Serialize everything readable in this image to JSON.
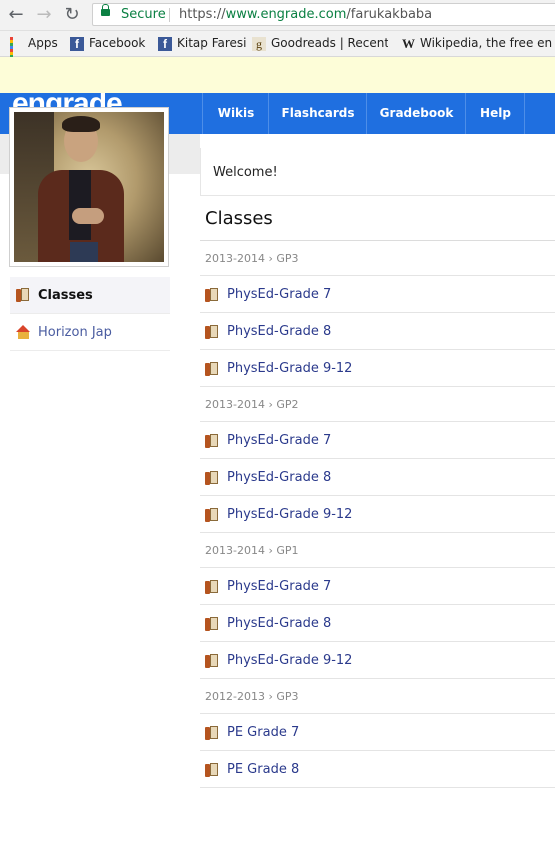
{
  "browser": {
    "secure_label": "Secure",
    "url_scheme": "https://",
    "url_host": "www.engrade.com",
    "url_path": "/farukakbaba",
    "bookmarks": [
      {
        "label": "Apps",
        "icon": "apps-grid-icon"
      },
      {
        "label": "Facebook",
        "icon": "facebook-icon"
      },
      {
        "label": "Kitap Faresi",
        "icon": "facebook-icon"
      },
      {
        "label": "Goodreads | Recent U",
        "icon": "goodreads-icon"
      },
      {
        "label": "Wikipedia, the free en",
        "icon": "wikipedia-icon"
      }
    ]
  },
  "site": {
    "logo": "engrade",
    "nav": [
      {
        "label": "Wikis"
      },
      {
        "label": "Flashcards"
      },
      {
        "label": "Gradebook"
      },
      {
        "label": "Help"
      }
    ],
    "colors": {
      "nav_bg": "#1f6fe0",
      "link": "#2b3a8c"
    }
  },
  "sidebar": {
    "items": [
      {
        "label": "Classes",
        "icon": "book-icon",
        "active": true
      },
      {
        "label": "Horizon Jap",
        "icon": "house-icon",
        "active": false
      }
    ]
  },
  "main": {
    "welcome": "Welcome!",
    "title": "Classes",
    "groups": [
      {
        "term": "2013-2014 › GP3",
        "classes": [
          "PhysEd-Grade 7",
          "PhysEd-Grade 8",
          "PhysEd-Grade 9-12"
        ]
      },
      {
        "term": "2013-2014 › GP2",
        "classes": [
          "PhysEd-Grade 7",
          "PhysEd-Grade 8",
          "PhysEd-Grade 9-12"
        ]
      },
      {
        "term": "2013-2014 › GP1",
        "classes": [
          "PhysEd-Grade 7",
          "PhysEd-Grade 8",
          "PhysEd-Grade 9-12"
        ]
      },
      {
        "term": "2012-2013 › GP3",
        "classes": [
          "PE Grade 7",
          "PE Grade 8"
        ]
      }
    ]
  }
}
